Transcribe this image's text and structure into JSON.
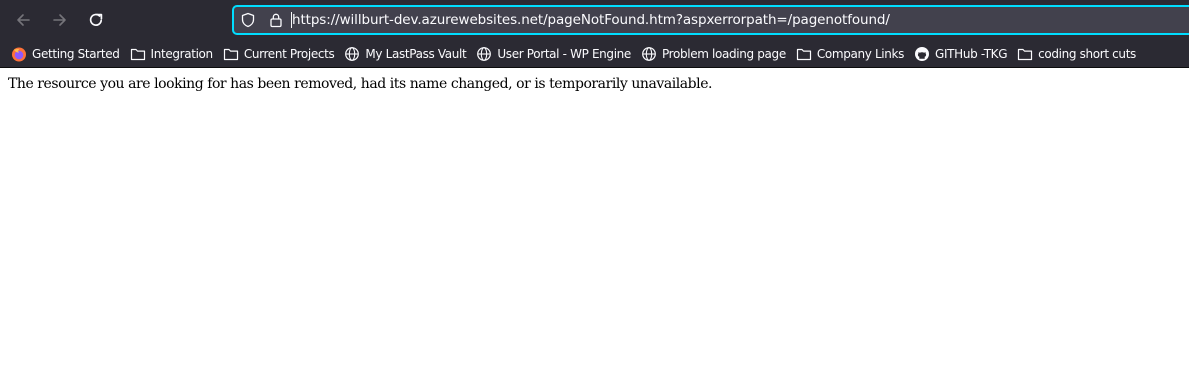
{
  "browser": {
    "icons": {
      "back": "arrow-left-icon",
      "forward": "arrow-right-icon",
      "reload": "reload-icon",
      "tracking": "shield-icon",
      "security": "lock-icon"
    },
    "url": "https://willburt-dev.azurewebsites.net/pageNotFound.htm?aspxerrorpath=/pagenotfound/"
  },
  "bookmarks": [
    {
      "label": "Getting Started",
      "icon": "firefox-icon"
    },
    {
      "label": "Integration",
      "icon": "folder-icon"
    },
    {
      "label": "Current Projects",
      "icon": "folder-icon"
    },
    {
      "label": "My LastPass Vault",
      "icon": "globe-icon"
    },
    {
      "label": "User Portal - WP Engine",
      "icon": "globe-icon"
    },
    {
      "label": "Problem loading page",
      "icon": "globe-icon"
    },
    {
      "label": "Company Links",
      "icon": "folder-icon"
    },
    {
      "label": "GITHub -TKG",
      "icon": "github-icon"
    },
    {
      "label": "coding short cuts",
      "icon": "folder-icon"
    }
  ],
  "page": {
    "message": "The resource you are looking for has been removed, had its name changed, or is temporarily unavailable."
  },
  "colors": {
    "toolbar_bg": "#2b2a33",
    "urlbar_bg": "#42414d",
    "focus_ring": "#00ddff",
    "text_light": "#fbfbfe"
  }
}
